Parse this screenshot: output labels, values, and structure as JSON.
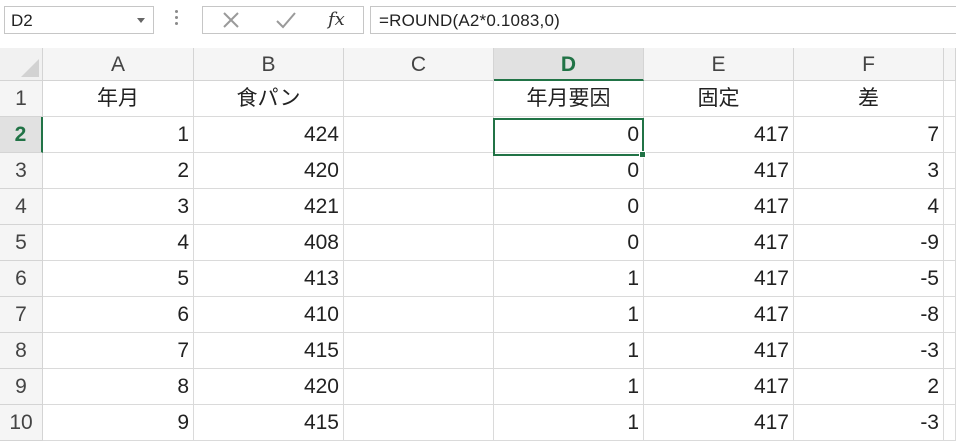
{
  "name_box": {
    "value": "D2"
  },
  "formula_bar": {
    "formula": "=ROUND(A2*0.1083,0)",
    "fx_label": "fx"
  },
  "columns": [
    "A",
    "B",
    "C",
    "D",
    "E",
    "F"
  ],
  "selected_column": "D",
  "selected_row": "2",
  "headers": {
    "A": "年月",
    "B": "食パン",
    "C": "",
    "D": "年月要因",
    "E": "固定",
    "F": "差"
  },
  "rows": [
    {
      "row": "1",
      "cells": [
        "年月",
        "食パン",
        "",
        "年月要因",
        "固定",
        "差"
      ]
    },
    {
      "row": "2",
      "cells": [
        "1",
        "424",
        "",
        "0",
        "417",
        "7"
      ]
    },
    {
      "row": "3",
      "cells": [
        "2",
        "420",
        "",
        "0",
        "417",
        "3"
      ]
    },
    {
      "row": "4",
      "cells": [
        "3",
        "421",
        "",
        "0",
        "417",
        "4"
      ]
    },
    {
      "row": "5",
      "cells": [
        "4",
        "408",
        "",
        "0",
        "417",
        "-9"
      ]
    },
    {
      "row": "6",
      "cells": [
        "5",
        "413",
        "",
        "1",
        "417",
        "-5"
      ]
    },
    {
      "row": "7",
      "cells": [
        "6",
        "410",
        "",
        "1",
        "417",
        "-8"
      ]
    },
    {
      "row": "8",
      "cells": [
        "7",
        "415",
        "",
        "1",
        "417",
        "-3"
      ]
    },
    {
      "row": "9",
      "cells": [
        "8",
        "420",
        "",
        "1",
        "417",
        "2"
      ]
    },
    {
      "row": "10",
      "cells": [
        "9",
        "415",
        "",
        "1",
        "417",
        "-3"
      ]
    }
  ],
  "colors": {
    "accent": "#217346"
  }
}
